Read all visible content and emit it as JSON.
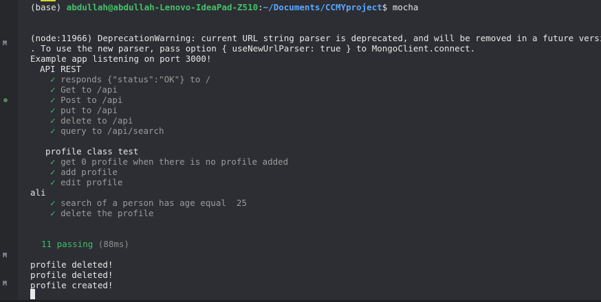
{
  "gutter": {
    "marks": [
      "M",
      "M",
      "M"
    ]
  },
  "prompt": {
    "env": "(base)",
    "user_host": "abdullah@abdullah-Lenovo-IdeaPad-Z510",
    "sep": ":",
    "path": "~/Documents/CCMYproject",
    "symbol": "$",
    "command": "mocha"
  },
  "output": {
    "deprecation_1": "(node:11966) DeprecationWarning: current URL string parser is deprecated, and will be removed in a future versi",
    "deprecation_2": ". To use the new parser, pass option { useNewUrlParser: true } to MongoClient.connect.",
    "listening": "Example app listening on port 3000!",
    "suite_api": "API REST",
    "api_tests": [
      "responds {\"status\":\"OK\"} to /",
      "Get to /api",
      "Post to /api",
      "put to /api",
      "delete to /api",
      "query to /api/search"
    ],
    "suite_profile": "profile class test",
    "profile_tests_1": [
      "get 0 profile when there is no profile added",
      "add profile",
      "edit profile"
    ],
    "log_ali": "ali",
    "profile_tests_2": [
      "search of a person has age equal  25",
      "delete the profile"
    ],
    "summary_passing": "11 passing",
    "summary_time": "(88ms)",
    "tail": [
      "profile deleted!",
      "profile deleted!",
      "profile created!"
    ],
    "check_glyph": "✓"
  }
}
